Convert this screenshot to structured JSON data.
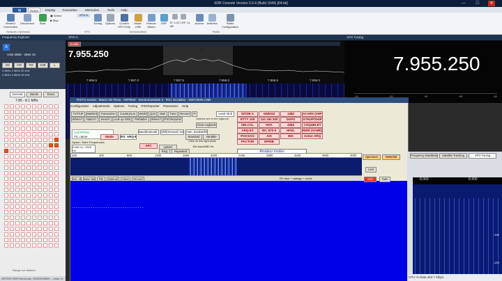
{
  "window": {
    "title": "SDR Console Version 3.0.4 (Build 1546) [64-bit]",
    "min": "—",
    "max": "☐",
    "close": "✕"
  },
  "ribbon_tabs": [
    "Home",
    "Display",
    "Favourites",
    "Memories",
    "Tools",
    "Help"
  ],
  "ribbon": {
    "buttons": [
      "Rewind Connection",
      "Disconnect",
      "Start",
      "Select",
      "Stop",
      "Tuning",
      "Options",
      "Current VFO Only",
      "Mode: USB",
      "Pseudo Stereo",
      "DSP",
      "Anchor",
      "Antenna",
      "Radio Configuration"
    ],
    "groups": [
      "Network (Optional)",
      "VFO",
      "Demodulation",
      "Radio"
    ],
    "filter_label": "IF: 1.00 | RF: 11 dB"
  },
  "left": {
    "header": "Frequency Explorer",
    "mode_label": "USB   3885 - 2884 Hz",
    "filters": [
      "AM",
      "CW",
      "FM",
      "SSB",
      "L"
    ],
    "steps": [
      "2.4kHz",
      "2.4kHz",
      "30 kHz",
      "2.4kHz",
      "2.4kHz",
      "25 kHz"
    ],
    "tabs": [
      "General",
      "Bands",
      "Direct"
    ],
    "range": "7.85 - 8.1 MHz",
    "range_hint": "Range not defined",
    "status": "AFEDRI SDR-Net Audio, 00002000600... Uses: tc"
  },
  "spectrum": {
    "label": "VFO-A",
    "freq": "7.955.250",
    "scale": [
      "7.956.5",
      "7.957.0",
      "7.957.5",
      "7.958.0",
      "7.958.5",
      "7.959.0"
    ],
    "marker": "A"
  },
  "vfo": {
    "header": "VFO Tuning",
    "freq": "7.955.250",
    "scale": [
      "-10",
      "-20",
      "-40",
      "-60",
      "-80"
    ]
  },
  "dialog": {
    "title": "RX/TX screen : Mauro De Rosa - IWP8ND  : Serotomonease 3 : RX1 Occitalos : SWITZERLAND",
    "menu": [
      "Configuration",
      "Adjustments",
      "Options",
      "Tuning",
      "PSKReporter",
      "Panoramic",
      "Help"
    ],
    "toolbar": [
      "TCP/UP",
      "Mainlink",
      "Transceiver",
      "Country/Lat",
      "World",
      "Q10",
      "Mail",
      "Tune",
      "Record",
      "IT"
    ],
    "row2": [
      "Where?",
      "Nation?",
      "Search",
      "Look up DXE",
      "Pathlabel",
      "Where?",
      "PSCReporter"
    ],
    "row3": [
      "TX: name",
      "Mode"
    ],
    "options_note": "Options are in the logbook",
    "logbook": "Clear Logbook",
    "level": "Level 26 $",
    "modes": [
      [
        "SITOR A",
        "GMDSS",
        "1382",
        "ACARS (VHF)"
      ],
      [
        "RTTY 100",
        "110 150 200",
        "DGPS",
        "SYNOP/SHIP"
      ],
      [
        "SELCAL",
        "HSA",
        "4284",
        "COQUELET"
      ],
      [
        "ARQ-E3",
        "IEC 870-5",
        "HFDL",
        "NWR (SAME)"
      ],
      [
        "POCSAG",
        "AIS",
        "BIS",
        "Amtor ARQ"
      ],
      [
        "PACTOR",
        "EPIRB",
        "",
        ""
      ]
    ],
    "amateur": "Amateur modes",
    "call_label": "Call RPMS",
    "baud": "Baud(manual) 184",
    "shift": "Shift(manual) 148",
    "auto_bw": "Auto. bandwidth",
    "standard": "Standard",
    "variable": "Variable",
    "click_hint": "Click on the right peak",
    "afc": "AFC",
    "letters": "Letters",
    "rx_arq": "RX: ARQ-E",
    "ring": "Ring",
    "repeated": "Repeated",
    "baud_note": "184 baud/380 Hz",
    "space": "Space / Mark Frequencies",
    "space_val": "2186 Hz / 2526 Hz",
    "scale": [
      "400",
      "800",
      "1200",
      "1600",
      "2000",
      "2400",
      "2800",
      "3200",
      "3600",
      "4000"
    ],
    "scale_left": "200",
    "rx_tools": [
      "Sel. all",
      "Save last",
      "File",
      "Manual",
      "Clear",
      "Record"
    ],
    "rx_right": "RX time + callsign + mode",
    "rx_line": "- - - - - - - - - - - - - - - - - - - - - - - - - - - - - - - - - -"
  },
  "right_win": {
    "tabs": [
      "Frequency Database",
      "Satellite Tracking",
      "VFO Tuning"
    ],
    "labels": [
      "Spectrum",
      "Waterfall"
    ],
    "values": [
      "Lock",
      "Gain",
      "AGC"
    ],
    "scale": [
      "8.060",
      "8.400"
    ],
    "y": [
      "-180",
      "-220"
    ],
    "status": "CPU  %      Data 463.7 Mbps"
  }
}
